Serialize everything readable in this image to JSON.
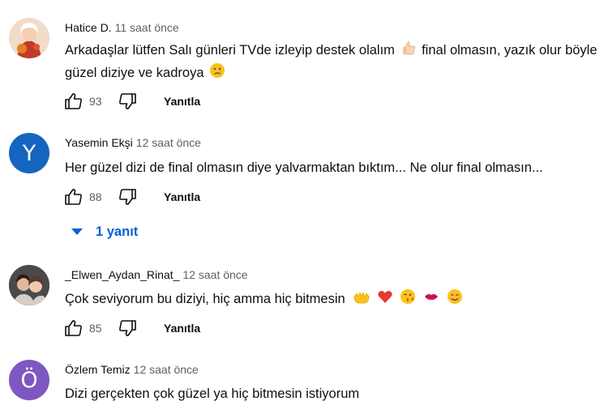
{
  "comments": [
    {
      "author": "Hatice D.",
      "time": "11 saat önce",
      "text_part1": "Arkadaşlar lütfen Salı günleri TVde izleyip destek olalım",
      "emoji1": "thumbs-up-emoji",
      "text_part2": "final olmasın, yazık olur böyle güzel diziye ve kadroya",
      "emoji2": "crying-face-emoji",
      "likes": "93",
      "reply_label": "Yanıtla",
      "avatar": "photo-avatar"
    },
    {
      "author": "Yasemin Ekşi",
      "time": "12 saat önce",
      "text": "Her güzel dizi de final olmasın diye yalvarmaktan bıktım... Ne olur final olmasın...",
      "likes": "88",
      "reply_label": "Yanıtla",
      "avatar_letter": "Y",
      "avatar_color": "#1565c0",
      "replies_label": "1 yanıt"
    },
    {
      "author": "_Elwen_Aydan_Rinat_",
      "time": "12 saat önce",
      "text": "Çok seviyorum bu diziyi, hiç amma hiç bitmesin",
      "emojis": [
        "palms-up-emoji",
        "red-heart-emoji",
        "face-blowing-kiss-emoji",
        "kiss-mark-emoji",
        "smiling-face-emoji"
      ],
      "likes": "85",
      "reply_label": "Yanıtla",
      "avatar": "photo-avatar"
    },
    {
      "author": "Özlem Temiz",
      "time": "12 saat önce",
      "text": "Dizi gerçekten çok güzel ya hiç bitmesin istiyorum",
      "avatar_letter": "Ö",
      "avatar_color": "#7e57c2"
    }
  ],
  "colors": {
    "link_blue": "#065fd4",
    "secondary_text": "#606060",
    "primary_text": "#0f0f0f"
  }
}
